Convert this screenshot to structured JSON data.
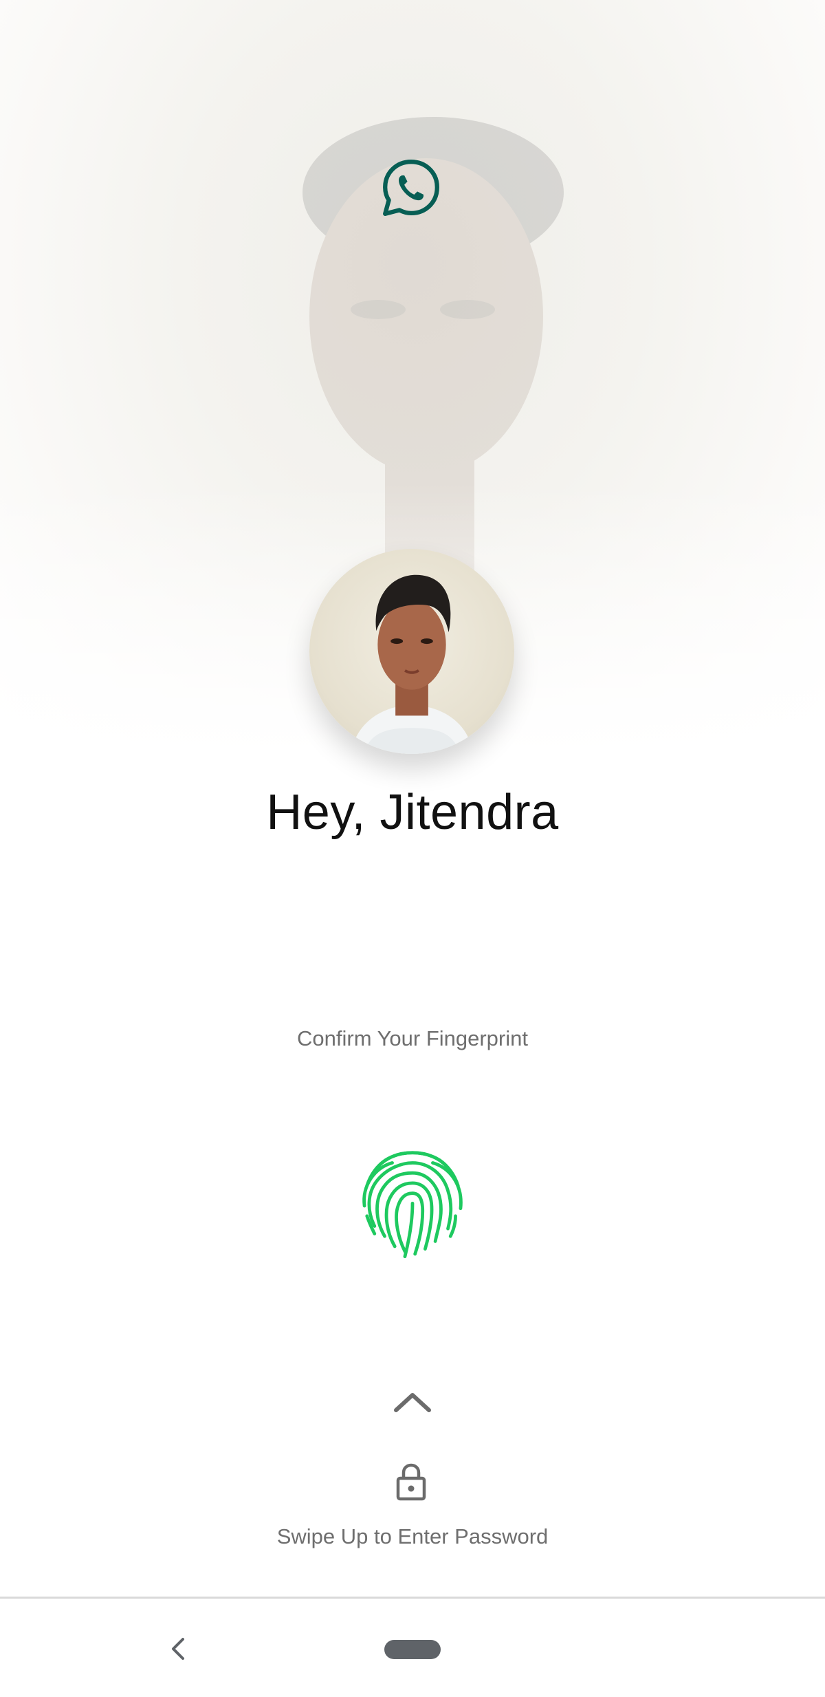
{
  "app": {
    "icon": "whatsapp-icon",
    "accent_color": "#075e54"
  },
  "profile": {
    "avatar": "avatar",
    "greeting": "Hey, Jitendra"
  },
  "auth": {
    "prompt": "Confirm Your Fingerprint",
    "fingerprint_icon": "fingerprint-icon",
    "fingerprint_color": "#1ec95f",
    "swipe_icon": "chevron-up-icon",
    "lock_icon": "lock-icon",
    "swipe_label": "Swipe Up to Enter Password"
  },
  "navigation": {
    "back_icon": "back-icon",
    "home_icon": "home-pill-icon"
  }
}
